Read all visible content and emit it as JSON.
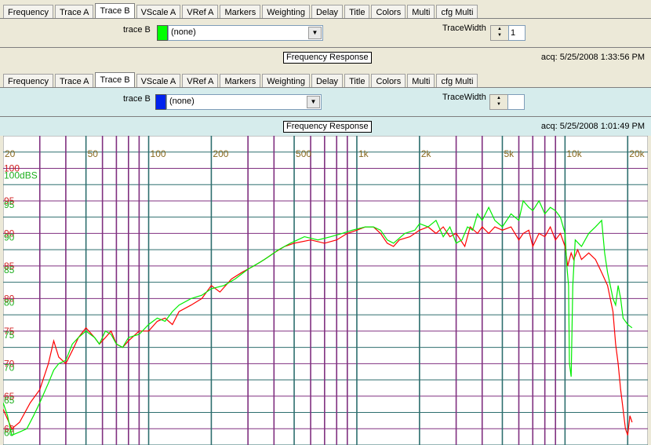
{
  "tabs_top": {
    "items": [
      "Frequency",
      "Trace A",
      "Trace B",
      "VScale A",
      "VRef A",
      "Markers",
      "Weighting",
      "Delay",
      "Title",
      "Colors",
      "Multi",
      "cfg Multi"
    ],
    "active": "Trace B"
  },
  "panel_top": {
    "trace_label": "trace B",
    "trace_color": "#00ff00",
    "trace_value": "(none)",
    "tracewidth_label": "TraceWidth",
    "tracewidth_value": "1",
    "graph_title": "Frequency Response",
    "acq": "acq: 5/25/2008 1:33:56 PM"
  },
  "tabs_bottom": {
    "items": [
      "Frequency",
      "Trace A",
      "Trace B",
      "VScale A",
      "VRef A",
      "Markers",
      "Weighting",
      "Delay",
      "Title",
      "Colors",
      "Multi",
      "cfg Multi"
    ],
    "active": "Trace B"
  },
  "panel_bottom": {
    "trace_label": "trace B",
    "trace_color": "#0022ee",
    "trace_value": "(none)",
    "tracewidth_label": "TraceWidth",
    "graph_title": "Frequency Response",
    "acq": "acq: 5/25/2008 1:01:49 PM"
  },
  "chart_data": {
    "type": "line",
    "title": "Frequency Response",
    "x_scale": "log",
    "xlim": [
      20,
      25000
    ],
    "ylim": [
      57.5,
      105
    ],
    "x_tick_labels": [
      {
        "f": 20,
        "text": "20"
      },
      {
        "f": 50,
        "text": "50"
      },
      {
        "f": 100,
        "text": "100"
      },
      {
        "f": 200,
        "text": "200"
      },
      {
        "f": 500,
        "text": "500"
      },
      {
        "f": 1000,
        "text": "1k"
      },
      {
        "f": 2000,
        "text": "2k"
      },
      {
        "f": 5000,
        "text": "5k"
      },
      {
        "f": 10000,
        "text": "10k"
      },
      {
        "f": 20000,
        "text": "20k"
      }
    ],
    "y_ticks_red": [
      60,
      65,
      70,
      75,
      80,
      85,
      90,
      95,
      100
    ],
    "y_ticks_green": [
      60,
      65,
      70,
      75,
      80,
      85,
      90,
      95
    ],
    "y_label_green": "100dBS",
    "gridline_colors": {
      "purple": "#803080",
      "teal": "#2d6e6e"
    },
    "vertical_grid_purple": [
      30,
      40,
      60,
      70,
      80,
      90,
      300,
      400,
      600,
      700,
      800,
      900,
      3000,
      4000,
      6000,
      7000,
      8000,
      9000
    ],
    "vertical_grid_teal": [
      50,
      100,
      200,
      500,
      1000,
      2000,
      5000,
      10000,
      20000
    ],
    "series": [
      {
        "color": "#ff0000",
        "points": [
          [
            20,
            63
          ],
          [
            22,
            60
          ],
          [
            24,
            61
          ],
          [
            27,
            64
          ],
          [
            30,
            66
          ],
          [
            33,
            70
          ],
          [
            35,
            73.5
          ],
          [
            37,
            71
          ],
          [
            40,
            70
          ],
          [
            43,
            72
          ],
          [
            46,
            74
          ],
          [
            50,
            75.5
          ],
          [
            55,
            74
          ],
          [
            58,
            73
          ],
          [
            62,
            74
          ],
          [
            66,
            75
          ],
          [
            70,
            73
          ],
          [
            75,
            72.5
          ],
          [
            80,
            73.5
          ],
          [
            90,
            75
          ],
          [
            100,
            75
          ],
          [
            110,
            76.5
          ],
          [
            120,
            77
          ],
          [
            130,
            76
          ],
          [
            140,
            78
          ],
          [
            160,
            79
          ],
          [
            180,
            80
          ],
          [
            200,
            82
          ],
          [
            220,
            81
          ],
          [
            250,
            83
          ],
          [
            280,
            84
          ],
          [
            320,
            85
          ],
          [
            360,
            86
          ],
          [
            400,
            87
          ],
          [
            450,
            88
          ],
          [
            500,
            88.5
          ],
          [
            600,
            89
          ],
          [
            700,
            88.5
          ],
          [
            800,
            89
          ],
          [
            900,
            90
          ],
          [
            1000,
            90.5
          ],
          [
            1100,
            91
          ],
          [
            1200,
            91
          ],
          [
            1300,
            90
          ],
          [
            1400,
            88.5
          ],
          [
            1500,
            88
          ],
          [
            1600,
            89
          ],
          [
            1800,
            89.5
          ],
          [
            2000,
            90.5
          ],
          [
            2200,
            91
          ],
          [
            2400,
            90
          ],
          [
            2600,
            91
          ],
          [
            2800,
            89.5
          ],
          [
            3000,
            90
          ],
          [
            3300,
            88
          ],
          [
            3500,
            91
          ],
          [
            3800,
            90
          ],
          [
            4000,
            91
          ],
          [
            4300,
            90
          ],
          [
            4600,
            91
          ],
          [
            5000,
            90.5
          ],
          [
            5500,
            91
          ],
          [
            6000,
            89
          ],
          [
            6300,
            90
          ],
          [
            6700,
            90.5
          ],
          [
            7000,
            88
          ],
          [
            7500,
            90
          ],
          [
            8000,
            89.5
          ],
          [
            8500,
            91
          ],
          [
            9000,
            89
          ],
          [
            9500,
            90
          ],
          [
            10000,
            88
          ],
          [
            10300,
            85
          ],
          [
            10700,
            87
          ],
          [
            11000,
            86
          ],
          [
            11500,
            87.5
          ],
          [
            12000,
            86
          ],
          [
            13000,
            87
          ],
          [
            14000,
            86
          ],
          [
            15000,
            84
          ],
          [
            16000,
            82
          ],
          [
            17000,
            78
          ],
          [
            17500,
            73
          ],
          [
            18000,
            70
          ],
          [
            18500,
            66
          ],
          [
            19000,
            63
          ],
          [
            19500,
            60
          ],
          [
            20000,
            59
          ],
          [
            20500,
            62
          ],
          [
            21000,
            61
          ]
        ]
      },
      {
        "color": "#00ee00",
        "points": [
          [
            20,
            64
          ],
          [
            21,
            62
          ],
          [
            22,
            59
          ],
          [
            24,
            59.5
          ],
          [
            26,
            60
          ],
          [
            28,
            62
          ],
          [
            30,
            64
          ],
          [
            33,
            67
          ],
          [
            35,
            69
          ],
          [
            37,
            70
          ],
          [
            40,
            70.5
          ],
          [
            43,
            73
          ],
          [
            46,
            74
          ],
          [
            50,
            75
          ],
          [
            55,
            74
          ],
          [
            58,
            73
          ],
          [
            62,
            75
          ],
          [
            66,
            74.5
          ],
          [
            70,
            73
          ],
          [
            75,
            72.5
          ],
          [
            80,
            74
          ],
          [
            90,
            74.5
          ],
          [
            100,
            76
          ],
          [
            110,
            77
          ],
          [
            120,
            76.5
          ],
          [
            130,
            78
          ],
          [
            140,
            79
          ],
          [
            160,
            80
          ],
          [
            180,
            80.5
          ],
          [
            200,
            81.5
          ],
          [
            230,
            82
          ],
          [
            260,
            83
          ],
          [
            300,
            84.5
          ],
          [
            340,
            85.5
          ],
          [
            380,
            86.5
          ],
          [
            420,
            87.5
          ],
          [
            480,
            88.5
          ],
          [
            560,
            89.5
          ],
          [
            650,
            89
          ],
          [
            750,
            89.5
          ],
          [
            850,
            90
          ],
          [
            950,
            90.5
          ],
          [
            1100,
            91
          ],
          [
            1200,
            91
          ],
          [
            1300,
            90.5
          ],
          [
            1400,
            89
          ],
          [
            1500,
            88.5
          ],
          [
            1700,
            90
          ],
          [
            1900,
            90.5
          ],
          [
            2000,
            91.5
          ],
          [
            2200,
            91
          ],
          [
            2400,
            92
          ],
          [
            2600,
            89.5
          ],
          [
            2800,
            91
          ],
          [
            3000,
            88.5
          ],
          [
            3200,
            89
          ],
          [
            3400,
            91
          ],
          [
            3600,
            90.5
          ],
          [
            3800,
            93
          ],
          [
            4000,
            92
          ],
          [
            4300,
            94
          ],
          [
            4600,
            92
          ],
          [
            5000,
            91
          ],
          [
            5500,
            93
          ],
          [
            6000,
            92
          ],
          [
            6300,
            95
          ],
          [
            6700,
            94
          ],
          [
            7000,
            93.5
          ],
          [
            7500,
            95
          ],
          [
            8000,
            93
          ],
          [
            8500,
            94
          ],
          [
            9000,
            93.5
          ],
          [
            9500,
            92.5
          ],
          [
            10000,
            90
          ],
          [
            10200,
            85
          ],
          [
            10400,
            82
          ],
          [
            10500,
            70
          ],
          [
            10700,
            68
          ],
          [
            10900,
            82
          ],
          [
            11200,
            89
          ],
          [
            12000,
            88
          ],
          [
            13000,
            90
          ],
          [
            14000,
            91
          ],
          [
            15000,
            92
          ],
          [
            15500,
            87
          ],
          [
            16000,
            84
          ],
          [
            16500,
            82
          ],
          [
            17000,
            80
          ],
          [
            17500,
            79
          ],
          [
            18000,
            82
          ],
          [
            18500,
            80
          ],
          [
            19000,
            77
          ],
          [
            20000,
            76
          ],
          [
            21000,
            75.5
          ]
        ]
      }
    ]
  }
}
